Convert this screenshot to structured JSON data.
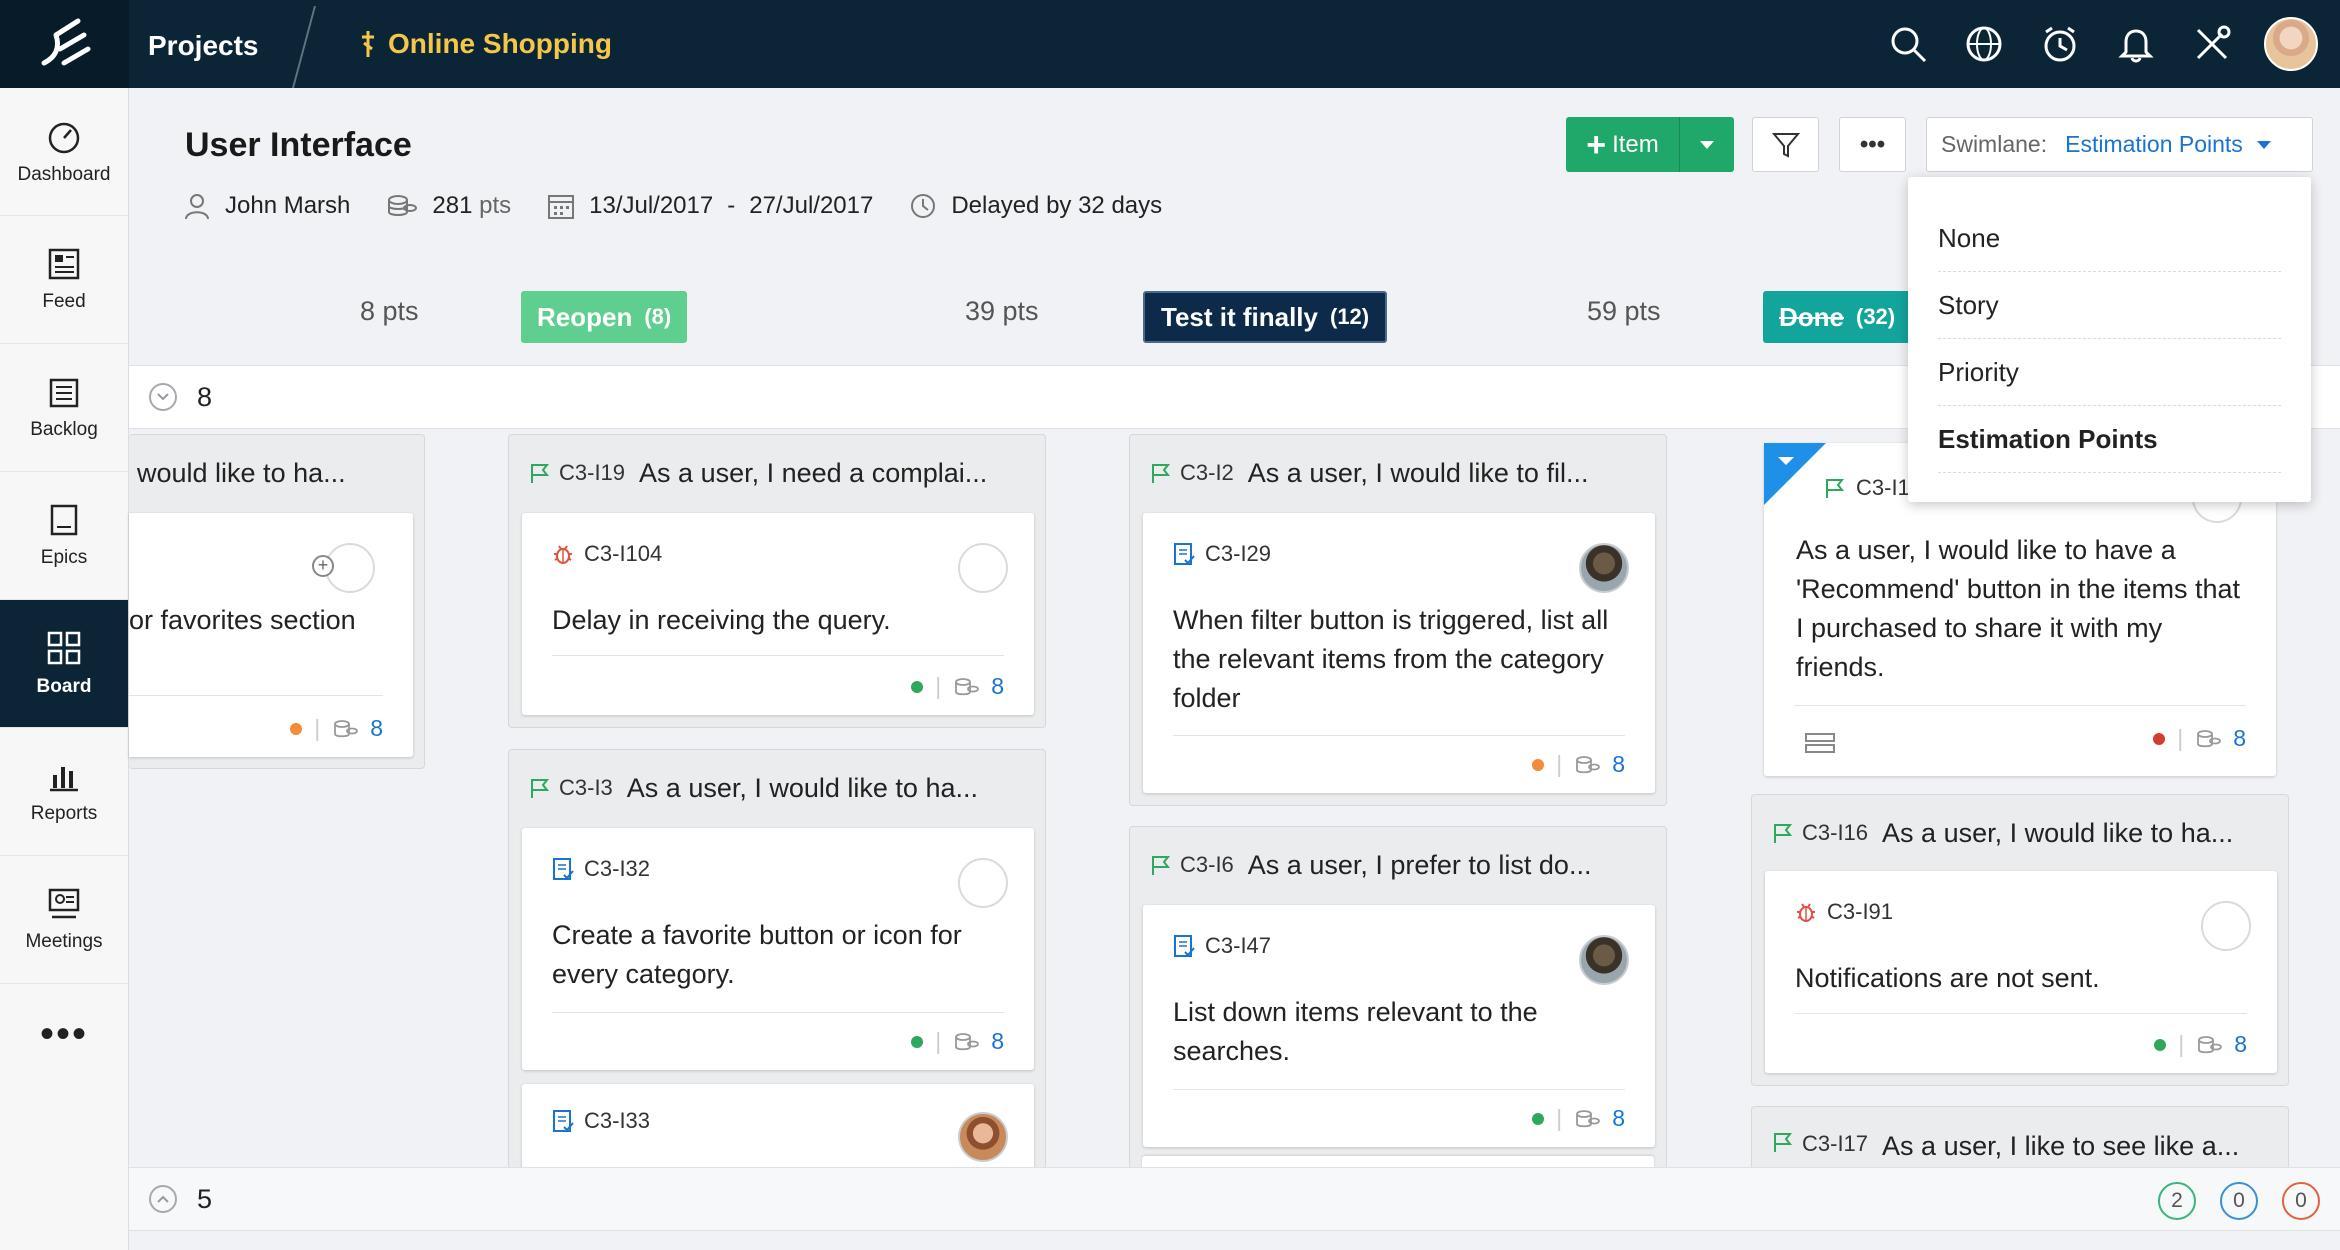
{
  "topbar": {
    "projects_label": "Projects",
    "project_name": "Online Shopping"
  },
  "sidebar": {
    "items": [
      {
        "label": "Dashboard"
      },
      {
        "label": "Feed"
      },
      {
        "label": "Backlog"
      },
      {
        "label": "Epics"
      },
      {
        "label": "Board"
      },
      {
        "label": "Reports"
      },
      {
        "label": "Meetings"
      }
    ],
    "more": "•••"
  },
  "sprint": {
    "title": "User Interface",
    "owner": "John Marsh",
    "points": "281",
    "points_unit": "pts",
    "start_date": "13/Jul/2017",
    "date_sep": "-",
    "end_date": "27/Jul/2017",
    "delay": "Delayed by 32 days"
  },
  "toolbar": {
    "add_item": "Item",
    "more": "•••",
    "swimlane_label": "Swimlane:",
    "swimlane_value": "Estimation Points"
  },
  "columns": [
    {
      "pts": "8 pts"
    },
    {
      "pts": "39 pts",
      "status": "Reopen",
      "count": "(8)",
      "color": "#5fcf8f"
    },
    {
      "pts": "59 pts",
      "status": "Test it finally",
      "count": "(12)",
      "color": "#0e2a4a"
    },
    {
      "status": "Done",
      "count": "(32)",
      "color": "#13a59c"
    }
  ],
  "lanes": [
    {
      "label": "8"
    },
    {
      "label": "5",
      "badges": [
        {
          "value": "2",
          "color": "#3bb57c"
        },
        {
          "value": "0",
          "color": "#3d8fd6"
        },
        {
          "value": "0",
          "color": "#e0623f"
        }
      ]
    }
  ],
  "stories": {
    "s0": {
      "title": "would like to ha...",
      "task_title": "or favorites section",
      "points": "8"
    },
    "s1": {
      "id": "C3-I19",
      "title": "As a user, I need a complai...",
      "task_id": "C3-I104",
      "task_title": "Delay in receiving the query.",
      "points": "8"
    },
    "s2": {
      "id": "C3-I3",
      "title": "As a user, I would like to ha...",
      "task_id": "C3-I32",
      "task_title": "Create a favorite button or icon for every category.",
      "points": "8",
      "task2_id": "C3-I33"
    },
    "s3": {
      "id": "C3-I2",
      "title": "As a user, I would like to fil...",
      "task_id": "C3-I29",
      "task_title": "When filter button is triggered, list all the relevant items from the category folder",
      "points": "8"
    },
    "s4": {
      "id": "C3-I6",
      "title": "As a user, I prefer to list do...",
      "task_id": "C3-I47",
      "task_title": "List down items relevant to the searches.",
      "points": "8"
    },
    "s5": {
      "id": "C3-I15",
      "task_title": "As a user, I would like to have a 'Recommend' button in the items that I purchased to share it with my friends.",
      "points": "8"
    },
    "s6": {
      "id": "C3-I16",
      "title": "As a user, I would like to ha...",
      "task_id": "C3-I91",
      "task_title": "Notifications are not sent.",
      "points": "8"
    },
    "s7": {
      "id": "C3-I17",
      "title": "As a user, I like to see like a..."
    }
  },
  "swimlane_menu": {
    "options": [
      "None",
      "Story",
      "Priority",
      "Estimation Points"
    ],
    "selected": "Estimation Points"
  },
  "colors": {
    "green_dot": "#2ea85f",
    "orange_dot": "#f28b3a",
    "red_dot": "#d33d2f",
    "link": "#1874d1"
  }
}
